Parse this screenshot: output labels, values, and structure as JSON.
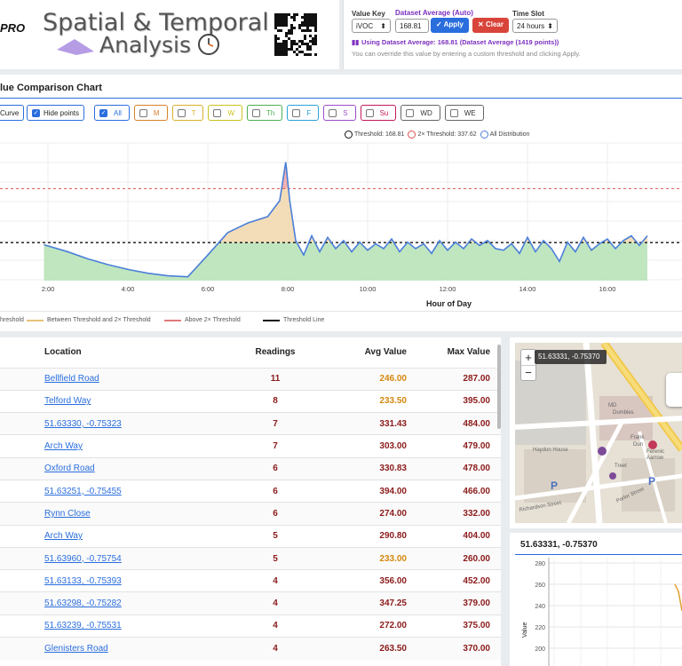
{
  "header": {
    "logo_text": "PRO",
    "title_line1": "Spatial & Temporal",
    "title_line2": "Analysis",
    "value_key_label": "Value Key",
    "value_key_selected": "iVOC",
    "dataset_avg_label": "Dataset Average (Auto)",
    "dataset_avg_value": "168.81",
    "apply_label": "Apply",
    "clear_label": "Clear",
    "time_slot_label": "Time Slot",
    "time_slot_selected": "24 hours",
    "using_text": "Using Dataset Average: 168.81 (Dataset Average (1419 points))",
    "override_hint": "You can override this value by entering a custom threshold and clicking Apply."
  },
  "chart_panel": {
    "title": "lue Comparison Chart",
    "curve_label": "Curve",
    "hide_points_label": "Hide points",
    "day_filters": [
      {
        "label": "All",
        "color": "#2a6ede",
        "checked": true
      },
      {
        "label": "M",
        "color": "#d9822b",
        "checked": false
      },
      {
        "label": "T",
        "color": "#d9b12b",
        "checked": false
      },
      {
        "label": "W",
        "color": "#c9c21b",
        "checked": false
      },
      {
        "label": "Th",
        "color": "#4caf50",
        "checked": false
      },
      {
        "label": "F",
        "color": "#2ba3d9",
        "checked": false
      },
      {
        "label": "S",
        "color": "#9c4dcc",
        "checked": false
      },
      {
        "label": "Su",
        "color": "#c2185b",
        "checked": false
      },
      {
        "label": "WD",
        "color": "#666666",
        "checked": false
      },
      {
        "label": "WE",
        "color": "#666666",
        "checked": false
      }
    ],
    "top_legend": [
      "Threshold: 168.81",
      "2× Threshold: 337.62",
      "All Distribution"
    ],
    "bottom_legend": [
      "hreshold",
      "Between Threshold and 2× Threshold",
      "Above 2× Threshold",
      "Threshold Line"
    ],
    "colors": {
      "below": "#b9e3b9",
      "between": "#f2d9b0",
      "above": "#f0a8a8",
      "line": "#4a7fd8",
      "threshold": "#111111",
      "double": "#e05050"
    }
  },
  "chart_data": {
    "type": "line",
    "xlabel": "Hour of Day",
    "ylabel": "",
    "x_ticks": [
      "2:00",
      "4:00",
      "6:00",
      "8:00",
      "10:00",
      "12:00",
      "14:00",
      "16:00"
    ],
    "threshold": 168.81,
    "double_threshold": 337.62,
    "ylim": [
      50,
      480
    ],
    "x": [
      1.9,
      2.5,
      3,
      3.5,
      4,
      4.5,
      5,
      5.5,
      6,
      6.5,
      7,
      7.5,
      7.8,
      7.95,
      8.05,
      8.2,
      8.4,
      8.6,
      8.8,
      9,
      9.2,
      9.4,
      9.6,
      9.8,
      10,
      10.2,
      10.4,
      10.6,
      10.8,
      11,
      11.2,
      11.4,
      11.6,
      11.8,
      12,
      12.2,
      12.4,
      12.6,
      12.8,
      13,
      13.2,
      13.4,
      13.6,
      13.8,
      14,
      14.2,
      14.4,
      14.6,
      14.8,
      15,
      15.2,
      15.4,
      15.6,
      15.8,
      16,
      16.2,
      16.4,
      16.6,
      16.8,
      17
    ],
    "values": [
      162,
      140,
      118,
      100,
      85,
      73,
      65,
      62,
      130,
      200,
      230,
      250,
      300,
      420,
      300,
      175,
      130,
      190,
      140,
      185,
      150,
      175,
      140,
      170,
      145,
      165,
      150,
      180,
      140,
      170,
      150,
      165,
      135,
      175,
      145,
      170,
      150,
      180,
      160,
      175,
      150,
      145,
      165,
      135,
      185,
      140,
      175,
      150,
      110,
      170,
      140,
      185,
      145,
      165,
      180,
      150,
      175,
      190,
      160,
      190
    ]
  },
  "table": {
    "headers": [
      "Location",
      "Readings",
      "Avg Value",
      "Max Value"
    ],
    "rows": [
      {
        "location": "Bellfield Road",
        "readings": "11",
        "avg": "246.00",
        "max": "287.00",
        "avg_color": "#d4880f",
        "max_color": "#8b1a1a"
      },
      {
        "location": "Telford Way",
        "readings": "8",
        "avg": "233.50",
        "max": "395.00",
        "avg_color": "#d4880f",
        "max_color": "#8b1a1a"
      },
      {
        "location": "51.63330, -0.75323",
        "readings": "7",
        "avg": "331.43",
        "max": "484.00",
        "avg_color": "#8b1a1a",
        "max_color": "#8b1a1a"
      },
      {
        "location": "Arch Way",
        "readings": "7",
        "avg": "303.00",
        "max": "479.00",
        "avg_color": "#8b1a1a",
        "max_color": "#8b1a1a"
      },
      {
        "location": "Oxford Road",
        "readings": "6",
        "avg": "330.83",
        "max": "478.00",
        "avg_color": "#8b1a1a",
        "max_color": "#8b1a1a"
      },
      {
        "location": "51.63251, -0.75455",
        "readings": "6",
        "avg": "394.00",
        "max": "466.00",
        "avg_color": "#8b1a1a",
        "max_color": "#8b1a1a"
      },
      {
        "location": "Rynn Close",
        "readings": "6",
        "avg": "274.00",
        "max": "332.00",
        "avg_color": "#8b1a1a",
        "max_color": "#8b1a1a"
      },
      {
        "location": "Arch Way",
        "readings": "5",
        "avg": "290.80",
        "max": "404.00",
        "avg_color": "#8b1a1a",
        "max_color": "#8b1a1a"
      },
      {
        "location": "51.63960, -0.75754",
        "readings": "5",
        "avg": "233.00",
        "max": "260.00",
        "avg_color": "#d4880f",
        "max_color": "#8b1a1a"
      },
      {
        "location": "51.63133, -0.75393",
        "readings": "4",
        "avg": "356.00",
        "max": "452.00",
        "avg_color": "#8b1a1a",
        "max_color": "#8b1a1a"
      },
      {
        "location": "51.63298, -0.75282",
        "readings": "4",
        "avg": "347.25",
        "max": "379.00",
        "avg_color": "#8b1a1a",
        "max_color": "#8b1a1a"
      },
      {
        "location": "51.63239, -0.75531",
        "readings": "4",
        "avg": "272.00",
        "max": "375.00",
        "avg_color": "#8b1a1a",
        "max_color": "#8b1a1a"
      },
      {
        "location": "Glenisters Road",
        "readings": "4",
        "avg": "263.50",
        "max": "370.00",
        "avg_color": "#8b1a1a",
        "max_color": "#8b1a1a"
      }
    ]
  },
  "map": {
    "coord_badge": "51.63331, -0.75370",
    "zoom_in": "+",
    "zoom_out": "−",
    "labels": [
      "MD",
      "Haydon House",
      "Frank",
      "Dun",
      "Dumbles",
      "Ferenic",
      "Aarrow",
      "Treet",
      "Parlor Street",
      "Richardson Street"
    ]
  },
  "mini_chart": {
    "title": "51.63331, -0.75370",
    "y_ticks": [
      "280",
      "260",
      "240",
      "220",
      "200"
    ],
    "ylabel": "Value"
  }
}
